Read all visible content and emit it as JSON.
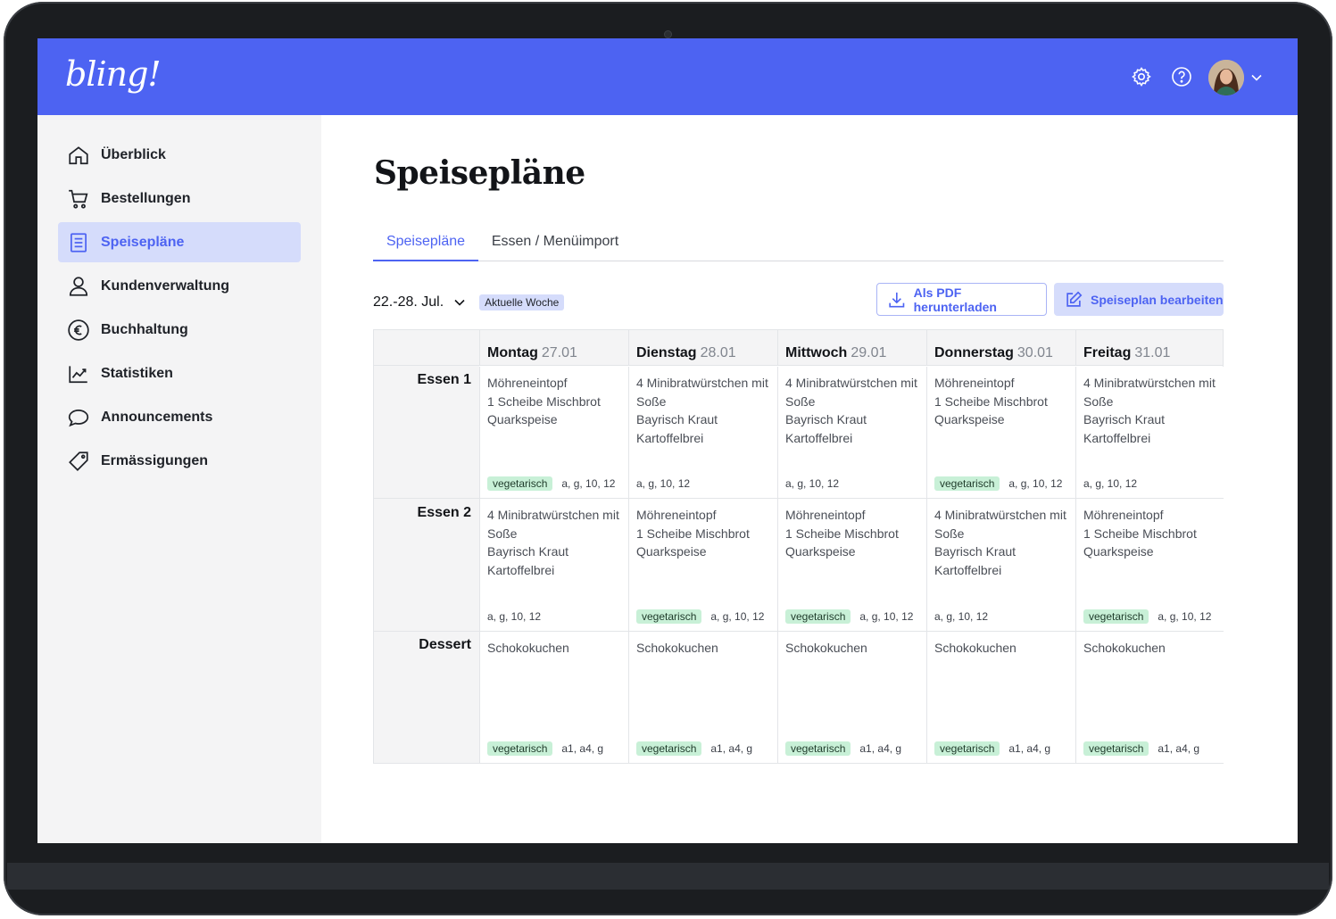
{
  "app": {
    "logo_text": "bling!",
    "brand_color": "#4d63f2",
    "header_icons": [
      "gear-icon",
      "help-icon",
      "avatar",
      "chevron-down-icon"
    ]
  },
  "sidebar": {
    "items": [
      {
        "label": "Überblick",
        "icon": "home-icon",
        "active": false
      },
      {
        "label": "Bestellungen",
        "icon": "cart-icon",
        "active": false
      },
      {
        "label": "Speisepläne",
        "icon": "document-icon",
        "active": true
      },
      {
        "label": "Kundenverwaltung",
        "icon": "user-icon",
        "active": false
      },
      {
        "label": "Buchhaltung",
        "icon": "euro-icon",
        "active": false
      },
      {
        "label": "Statistiken",
        "icon": "chart-icon",
        "active": false
      },
      {
        "label": "Announcements",
        "icon": "chat-icon",
        "active": false
      },
      {
        "label": "Ermässigungen",
        "icon": "tag-icon",
        "active": false
      }
    ]
  },
  "main": {
    "title": "Speisepläne",
    "tabs": [
      {
        "label": "Speisepläne",
        "active": true
      },
      {
        "label": "Essen / Menüimport",
        "active": false
      }
    ],
    "week": {
      "label": "22.-28. Jul.",
      "badge": "Aktuelle Woche"
    },
    "buttons": {
      "pdf": "Als PDF herunterladen",
      "edit": "Speiseplan bearbeiten"
    },
    "table": {
      "days": [
        {
          "name": "Montag",
          "date": "27.01"
        },
        {
          "name": "Dienstag",
          "date": "28.01"
        },
        {
          "name": "Mittwoch",
          "date": "29.01"
        },
        {
          "name": "Donnerstag",
          "date": "30.01"
        },
        {
          "name": "Freitag",
          "date": "31.01"
        }
      ],
      "rows": [
        {
          "label": "Essen 1",
          "cells": [
            {
              "lines": [
                "Möhreneintopf",
                "1 Scheibe Mischbrot",
                "Quarkspeise"
              ],
              "veg": "vegetarisch",
              "allergens": "a, g, 10, 12"
            },
            {
              "lines": [
                "4 Minibratwürstchen mit",
                "Soße",
                "Bayrisch Kraut",
                "Kartoffelbrei"
              ],
              "veg": "",
              "allergens": "a, g, 10, 12"
            },
            {
              "lines": [
                "4 Minibratwürstchen mit",
                "Soße",
                "Bayrisch Kraut",
                "Kartoffelbrei"
              ],
              "veg": "",
              "allergens": "a, g, 10, 12"
            },
            {
              "lines": [
                "Möhreneintopf",
                "1 Scheibe Mischbrot",
                "Quarkspeise"
              ],
              "veg": "vegetarisch",
              "allergens": "a, g, 10, 12"
            },
            {
              "lines": [
                "4 Minibratwürstchen mit",
                "Soße",
                "Bayrisch Kraut",
                "Kartoffelbrei"
              ],
              "veg": "",
              "allergens": "a, g, 10, 12"
            }
          ]
        },
        {
          "label": "Essen 2",
          "cells": [
            {
              "lines": [
                "4 Minibratwürstchen mit",
                "Soße",
                "Bayrisch Kraut",
                "Kartoffelbrei"
              ],
              "veg": "",
              "allergens": "a, g, 10, 12"
            },
            {
              "lines": [
                "Möhreneintopf",
                "1 Scheibe Mischbrot",
                "Quarkspeise"
              ],
              "veg": "vegetarisch",
              "allergens": "a, g, 10, 12"
            },
            {
              "lines": [
                "Möhreneintopf",
                "1 Scheibe Mischbrot",
                "Quarkspeise"
              ],
              "veg": "vegetarisch",
              "allergens": "a, g, 10, 12"
            },
            {
              "lines": [
                "4 Minibratwürstchen mit",
                "Soße",
                "Bayrisch Kraut",
                "Kartoffelbrei"
              ],
              "veg": "",
              "allergens": "a, g, 10, 12"
            },
            {
              "lines": [
                "Möhreneintopf",
                "1 Scheibe Mischbrot",
                "Quarkspeise"
              ],
              "veg": "vegetarisch",
              "allergens": "a, g, 10, 12"
            }
          ]
        },
        {
          "label": "Dessert",
          "cells": [
            {
              "lines": [
                "Schokokuchen"
              ],
              "veg": "vegetarisch",
              "allergens": "a1, a4, g"
            },
            {
              "lines": [
                "Schokokuchen"
              ],
              "veg": "vegetarisch",
              "allergens": "a1, a4, g"
            },
            {
              "lines": [
                "Schokokuchen"
              ],
              "veg": "vegetarisch",
              "allergens": "a1, a4, g"
            },
            {
              "lines": [
                "Schokokuchen"
              ],
              "veg": "vegetarisch",
              "allergens": "a1, a4, g"
            },
            {
              "lines": [
                "Schokokuchen"
              ],
              "veg": "vegetarisch",
              "allergens": "a1, a4, g"
            }
          ]
        }
      ]
    }
  }
}
